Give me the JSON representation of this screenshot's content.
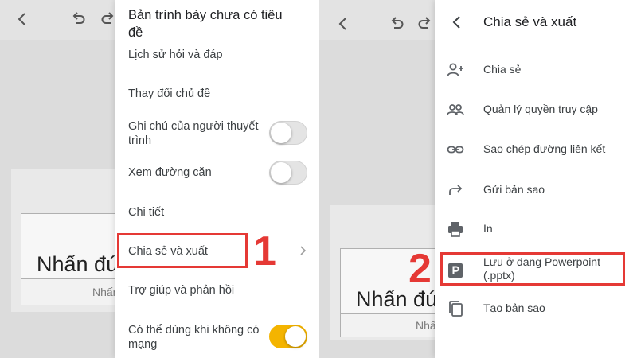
{
  "left": {
    "bg_title": "Nhấn đúp",
    "bg_subtitle": "Nhấn",
    "menu": {
      "title": "Bản trình bày chưa có tiêu đề",
      "items": [
        {
          "label": "Lịch sử hỏi và đáp"
        },
        {
          "label": "Thay đổi chủ đề"
        },
        {
          "label": "Ghi chú của người thuyết trình",
          "toggle": false
        },
        {
          "label": "Xem đường căn",
          "toggle": false
        },
        {
          "label": "Chi tiết"
        },
        {
          "label": "Chia sẻ và xuất"
        },
        {
          "label": "Trợ giúp và phản hồi"
        },
        {
          "label": "Có thể dùng khi không có mạng",
          "toggle": true
        }
      ]
    },
    "step_number": "1"
  },
  "right": {
    "bg_title": "Nhấn đú",
    "bg_subtitle": "Nhấ",
    "header_title": "Chia sẻ và xuất",
    "items": [
      {
        "label": "Chia sẻ",
        "icon": "person-add-icon"
      },
      {
        "label": "Quản lý quyền truy cập",
        "icon": "people-icon"
      },
      {
        "label": "Sao chép đường liên kết",
        "icon": "link-icon"
      },
      {
        "label": "Gửi bản sao",
        "icon": "forward-icon"
      },
      {
        "label": "In",
        "icon": "printer-icon"
      },
      {
        "label": "Lưu ở dạng Powerpoint (.pptx)",
        "icon": "powerpoint-icon"
      },
      {
        "label": "Tạo bản sao",
        "icon": "copy-icon"
      }
    ],
    "step_number": "2"
  },
  "colors": {
    "highlight": "#e53935",
    "toggle_on": "#f4b400",
    "toggle_off": "#e4e4e4"
  }
}
